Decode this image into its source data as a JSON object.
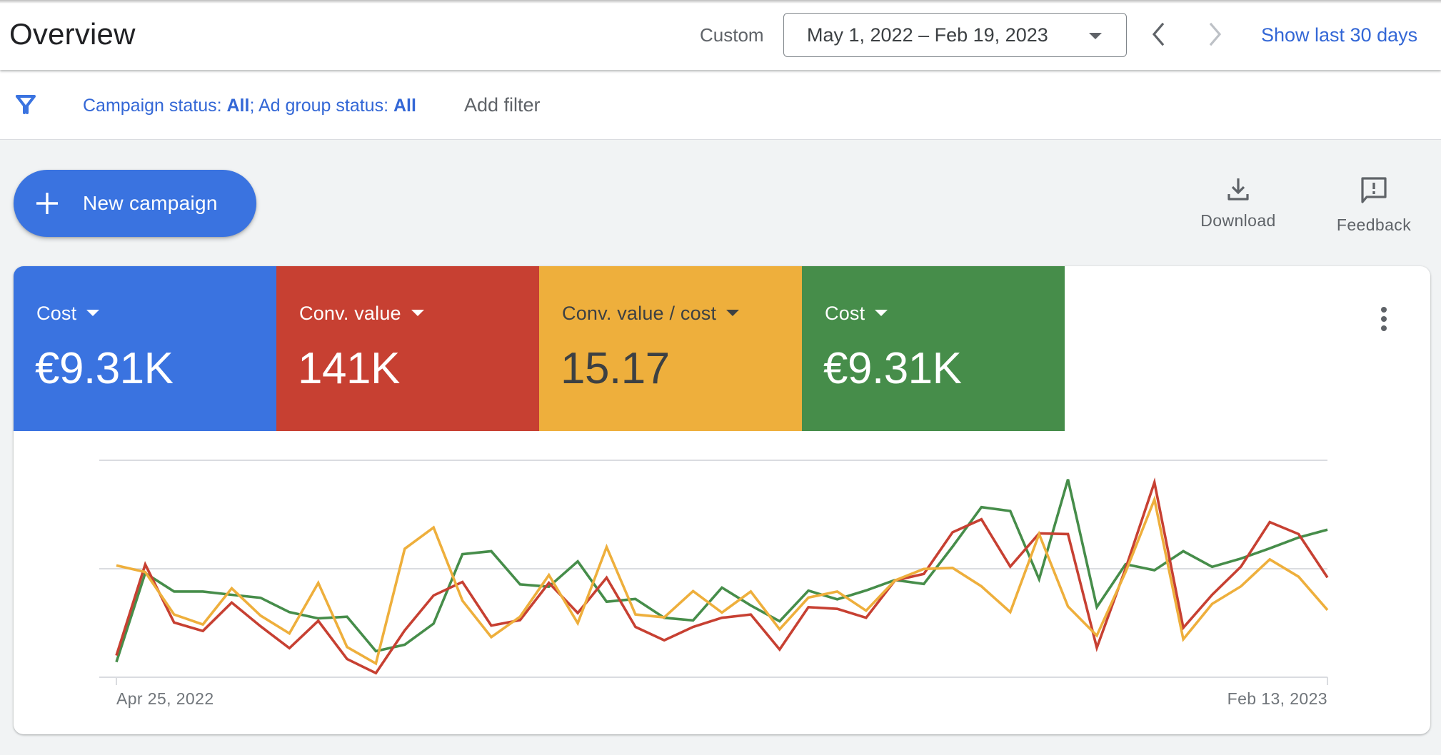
{
  "header": {
    "title": "Overview",
    "date_range_label": "Custom",
    "date_range_value": "May 1, 2022 – Feb 19, 2023",
    "prev_period_icon": "chevron-left-icon",
    "next_period_icon": "chevron-right-icon",
    "show_last_label": "Show last 30 days"
  },
  "filters": {
    "icon": "filter-icon",
    "campaign_status_label": "Campaign status: ",
    "campaign_status_value": "All",
    "separator": "; ",
    "ad_group_status_label": "Ad group status: ",
    "ad_group_status_value": "All",
    "add_filter_label": "Add filter"
  },
  "toolbar": {
    "new_campaign_label": "New campaign",
    "download_label": "Download",
    "feedback_label": "Feedback"
  },
  "colors": {
    "accent_blue": "#3a73e0",
    "link_blue": "#3367d6",
    "red": "#c74032",
    "yellow": "#eeaf3c",
    "green": "#468d4a"
  },
  "scorecards": [
    {
      "metric": "Cost",
      "value": "€9.31K",
      "color": "#3a73e0",
      "text_color": "#ffffff"
    },
    {
      "metric": "Conv. value",
      "value": "141K",
      "color": "#c74032",
      "text_color": "#ffffff"
    },
    {
      "metric": "Conv. value / cost",
      "value": "15.17",
      "color": "#eeaf3c",
      "text_color": "#3c4043"
    },
    {
      "metric": "Cost",
      "value": "€9.31K",
      "color": "#468d4a",
      "text_color": "#ffffff"
    }
  ],
  "chart_data": {
    "type": "line",
    "title": "",
    "xlabel": "",
    "ylabel": "",
    "x_start": "Apr 25, 2022",
    "x_end": "Feb 13, 2023",
    "x_tick_labels": [
      "Apr 25, 2022",
      "Feb 13, 2023"
    ],
    "x_interval": "weekly",
    "y_axis_labels_shown": false,
    "y_units": "relative (0 = bottom gridline, 100 = top gridline)",
    "ylim": [
      0,
      100
    ],
    "gridlines": [
      0,
      50,
      100
    ],
    "legend": "none",
    "series": [
      {
        "name": "Cost",
        "color": "#468d4a",
        "values": [
          7,
          48,
          39.5,
          39.5,
          38,
          36.6,
          30,
          27.1,
          27.9,
          12,
          15,
          24.7,
          56.7,
          58.1,
          42.8,
          41.7,
          53.4,
          34.8,
          36.1,
          27.4,
          26.2,
          41.3,
          33.1,
          25.8,
          39.9,
          35.9,
          40,
          44.8,
          43,
          60.2,
          78.4,
          76.6,
          45.2,
          91.2,
          32.3,
          52.1,
          49.3,
          58.1,
          50.9,
          54.7,
          59.4,
          64.4,
          68
        ]
      },
      {
        "name": "Conv. value",
        "color": "#c74032",
        "values": [
          10,
          52,
          25.2,
          21.3,
          34.4,
          23.5,
          13.4,
          26,
          8.4,
          1.9,
          21.6,
          37.7,
          43.9,
          23.8,
          26.3,
          43.5,
          29.6,
          45.9,
          23.2,
          17,
          23.2,
          27.4,
          28.9,
          12.8,
          32.3,
          31.5,
          27.4,
          44.6,
          47.6,
          66.8,
          72.8,
          51,
          66.3,
          66,
          13.6,
          50.1,
          89.8,
          22.8,
          38,
          51,
          71.5,
          66,
          46
        ]
      },
      {
        "name": "Conv. value / cost",
        "color": "#eeaf3c",
        "values": [
          51.5,
          48.5,
          28.9,
          24.3,
          41,
          28.4,
          20.2,
          43.5,
          13.9,
          6.3,
          59.2,
          69,
          35.3,
          18.5,
          27.9,
          47.1,
          24.9,
          60,
          28.9,
          27.6,
          39.7,
          29.8,
          39.5,
          22.1,
          36.7,
          39.5,
          30.7,
          44.6,
          49.9,
          50.4,
          41.9,
          30,
          66,
          32.6,
          19.2,
          48.5,
          81.9,
          17.5,
          33.8,
          41.9,
          54.3,
          46.3,
          31
        ]
      }
    ]
  }
}
